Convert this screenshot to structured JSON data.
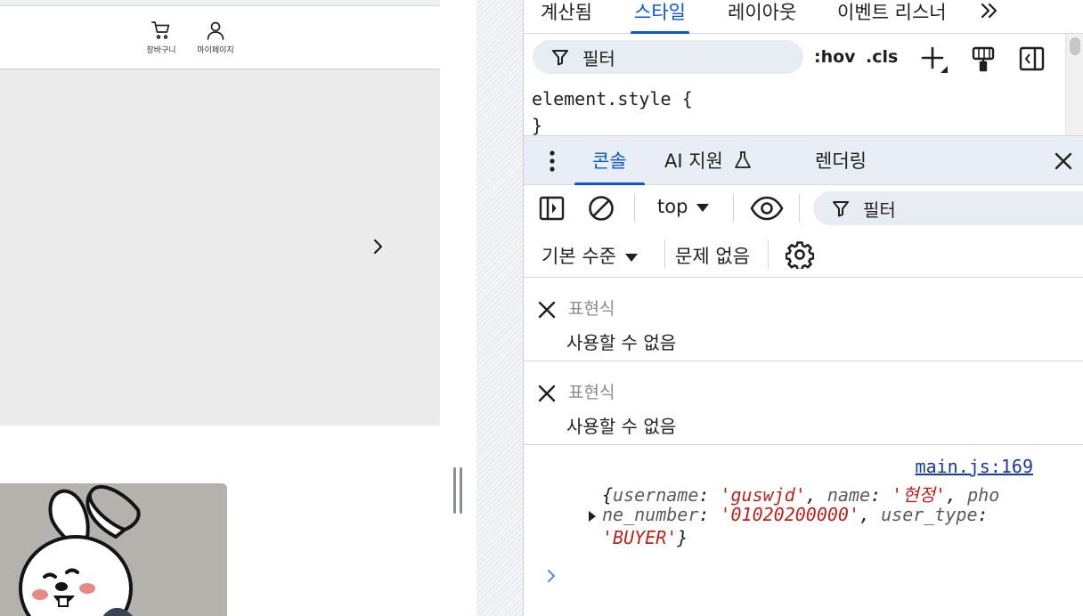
{
  "website": {
    "header": {
      "cart_label": "장바구니",
      "mypage_label": "마이페이지"
    }
  },
  "devtools": {
    "top_tabs": [
      "계산됨",
      "스타일",
      "레이아웃",
      "이벤트 리스너"
    ],
    "active_top_tab": "스타일",
    "styles_toolbar": {
      "filter_placeholder": "필터",
      "hov": ":hov",
      "cls": ".cls"
    },
    "style_rule": {
      "selector_line": "element.style {",
      "close_line": "}"
    },
    "drawer_tabs": [
      "콘솔",
      "AI 지원",
      "렌더링"
    ],
    "active_drawer_tab": "콘솔",
    "console_toolbar": {
      "context": "top",
      "filter_placeholder": "필터",
      "levels": "기본 수준",
      "issues": "문제 없음"
    },
    "live_expressions": [
      {
        "label": "표현식",
        "value": "사용할 수 없음"
      },
      {
        "label": "표현식",
        "value": "사용할 수 없음"
      }
    ],
    "log": {
      "source": "main.js:169",
      "k_username": "username",
      "v_username": "'guswjd'",
      "k_name": "name",
      "v_name": "'현정'",
      "k_phone_a": "pho",
      "k_phone_b": "ne_number",
      "v_phone": "'01020200000'",
      "k_user_type": "user_type",
      "v_user_type": "'BUYER'"
    },
    "colors": {
      "accent": "#0b57d0",
      "string": "#b3261e",
      "link": "#1a3c8f"
    }
  }
}
